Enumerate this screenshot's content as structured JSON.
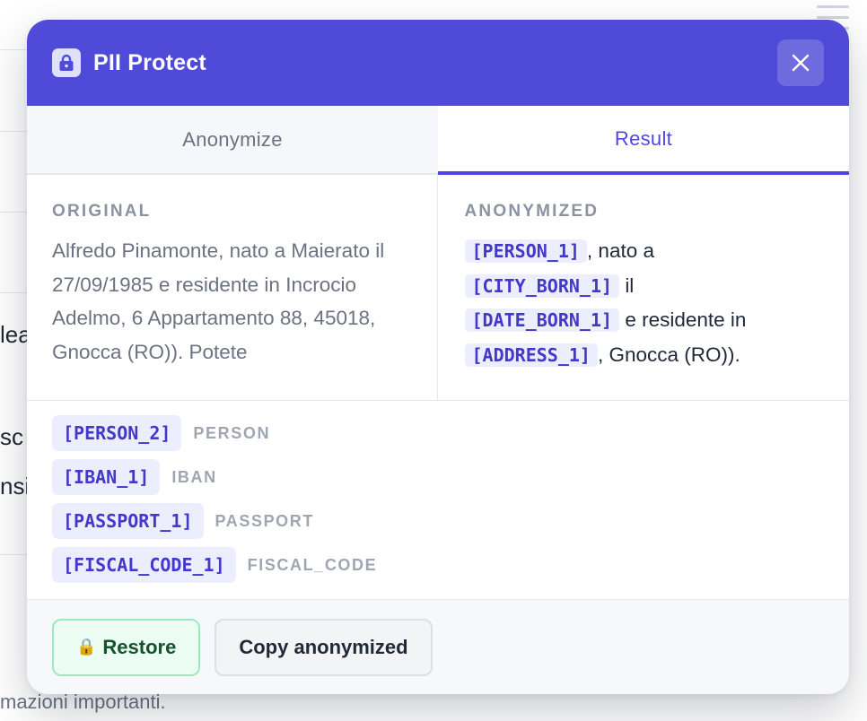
{
  "background": {
    "fragments": [
      "lea",
      "sc",
      "nsi"
    ],
    "footer_text": "mazioni importanti."
  },
  "app": {
    "title": "PII Protect",
    "logo_icon": "lock-icon",
    "close_icon": "close-icon",
    "accent_color": "#4f4bd8"
  },
  "tabs": [
    {
      "label": "Anonymize",
      "active": false
    },
    {
      "label": "Result",
      "active": true
    }
  ],
  "original": {
    "label": "ORIGINAL",
    "text": "Alfredo Pinamonte, nato a Maierato il 27/09/1985 e residente in Incrocio Adelmo, 6 Appartamento 88, 45018, Gnocca (RO)). Potete"
  },
  "anonymized": {
    "label": "ANONYMIZED",
    "tokens": [
      "[PERSON_1]",
      "[CITY_BORN_1]",
      "[DATE_BORN_1]",
      "[ADDRESS_1]"
    ],
    "segments": [
      ", nato a",
      "il",
      "e residente in",
      ", Gnocca (RO))."
    ]
  },
  "entities": [
    {
      "token": "[PERSON_2]",
      "type": "PERSON"
    },
    {
      "token": "[IBAN_1]",
      "type": "IBAN"
    },
    {
      "token": "[PASSPORT_1]",
      "type": "PASSPORT"
    },
    {
      "token": "[FISCAL_CODE_1]",
      "type": "FISCAL_CODE"
    }
  ],
  "actions": {
    "restore_icon": "lock-icon",
    "restore_label": "Restore",
    "copy_label": "Copy anonymized"
  }
}
